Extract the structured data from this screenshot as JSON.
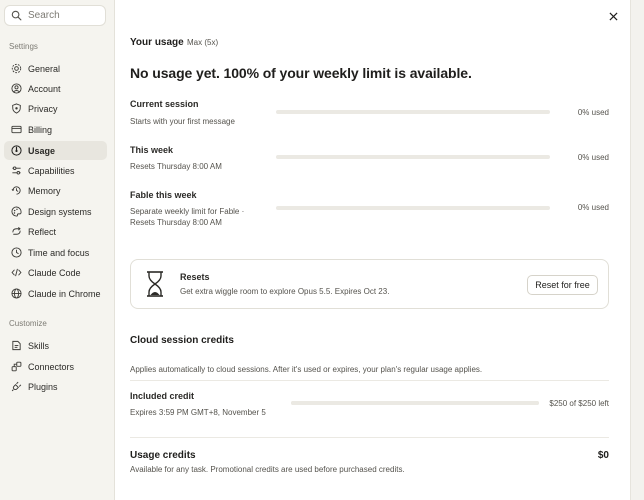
{
  "search": {
    "placeholder": "Search"
  },
  "sidebar": {
    "settings_label": "Settings",
    "settings_items": [
      {
        "label": "General",
        "icon": "gear-icon"
      },
      {
        "label": "Account",
        "icon": "user-circle-icon"
      },
      {
        "label": "Privacy",
        "icon": "shield-icon"
      },
      {
        "label": "Billing",
        "icon": "credit-card-icon"
      },
      {
        "label": "Usage",
        "icon": "gauge-icon"
      },
      {
        "label": "Capabilities",
        "icon": "sliders-icon"
      },
      {
        "label": "Memory",
        "icon": "memory-icon"
      },
      {
        "label": "Design systems",
        "icon": "palette-icon"
      },
      {
        "label": "Reflect",
        "icon": "reflect-icon"
      },
      {
        "label": "Time and focus",
        "icon": "clock-icon"
      },
      {
        "label": "Claude Code",
        "icon": "code-icon"
      },
      {
        "label": "Claude in Chrome",
        "icon": "globe-icon"
      }
    ],
    "customize_label": "Customize",
    "customize_items": [
      {
        "label": "Skills",
        "icon": "skills-icon"
      },
      {
        "label": "Connectors",
        "icon": "connectors-icon"
      },
      {
        "label": "Plugins",
        "icon": "plug-icon"
      }
    ],
    "active_item": "Usage"
  },
  "header": {
    "title": "Your usage",
    "plan": "Max (5x)"
  },
  "headline": "No usage yet. 100% of your weekly limit is available.",
  "usage_rows": [
    {
      "title": "Current session",
      "subtitle": "Starts with your first message",
      "percent_label": "0% used",
      "percent": 0
    },
    {
      "title": "This week",
      "subtitle": "Resets Thursday 8:00 AM",
      "percent_label": "0% used",
      "percent": 0
    },
    {
      "title": "Fable this week",
      "subtitle": "Separate weekly limit for Fable · Resets Thursday 8:00 AM",
      "percent_label": "0% used",
      "percent": 0
    }
  ],
  "resets": {
    "title": "Resets",
    "description": "Get extra wiggle room to explore Opus 5.5. Expires Oct 23.",
    "button_label": "Reset for free",
    "icon": "hourglass-icon"
  },
  "cloud_credits": {
    "title": "Cloud session credits",
    "description": "Applies automatically to cloud sessions. After it's used or expires, your plan's regular usage applies.",
    "included_title": "Included credit",
    "included_sub": "Expires 3:59 PM GMT+8, November 5",
    "amount_label": "$250 of $250 left",
    "remaining_fraction": 1.0
  },
  "usage_credits": {
    "title": "Usage credits",
    "description": "Available for any task. Promotional credits are used before purchased credits.",
    "amount": "$0"
  },
  "colors": {
    "sidebar_bg": "#f5f4ef",
    "active_bg": "#e8e6df",
    "bar_track": "#ebe9e3"
  }
}
